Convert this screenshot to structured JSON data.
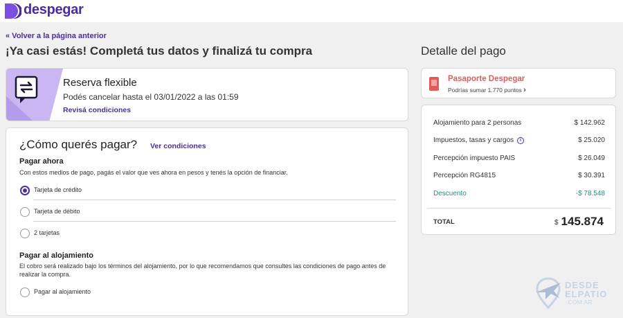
{
  "brand": {
    "name": "despegar",
    "color": "#4b2ca0"
  },
  "nav": {
    "back_label": "« Volver a la página anterior"
  },
  "header": {
    "title": "¡Ya casi estás! Completá tus datos y finalizá tu compra",
    "summary_title": "Detalle del pago"
  },
  "flexible": {
    "title": "Reserva flexible",
    "subtitle": "Podés cancelar hasta el 03/01/2022 a las 01:59",
    "link": "Revisá condiciones",
    "icon": "exchange-arrows-icon"
  },
  "payment": {
    "title": "¿Cómo querés pagar?",
    "conditions_link": "Ver condiciones",
    "pay_now": {
      "title": "Pagar ahora",
      "description": "Con estos medios de pago, pagás el valor que ves ahora en pesos y tenés la opción de financiar.",
      "options": [
        {
          "label": "Tarjeta de crédito",
          "selected": true
        },
        {
          "label": "Tarjeta de débito",
          "selected": false
        },
        {
          "label": "2 tarjetas",
          "selected": false
        }
      ]
    },
    "pay_at_hotel": {
      "title": "Pagar al alojamiento",
      "description": "El cobro será realizado bajo los términos del alojamiento, por lo que recomendamos que consultes las condiciones de pago antes de realizar la compra.",
      "options": [
        {
          "label": "Pagar al alojamiento",
          "selected": false
        }
      ]
    }
  },
  "passport": {
    "title": "Pasaporte Despegar",
    "subtitle": "Podrías sumar 1.770 puntos",
    "chevron": "›",
    "color": "#e25b5b"
  },
  "price": {
    "rows": [
      {
        "label": "Alojamiento para 2 personas",
        "value": "$ 142.962"
      },
      {
        "label": "Impuestos, tasas y cargos",
        "value": "$ 25.020",
        "info": "i"
      },
      {
        "label": "Percepción impuesto PAIS",
        "value": "$ 26.049"
      },
      {
        "label": "Percepción RG4815",
        "value": "$ 30.391"
      },
      {
        "label": "Descuento",
        "value": "-$ 78.548"
      }
    ],
    "discount_color": "#1f8f7a",
    "total_label": "TOTAL",
    "total_currency": "$",
    "total_value": "145.874"
  },
  "watermark": {
    "line1": "DESDE",
    "line2": "ELPATIO",
    "line3": ".COM.AR"
  }
}
